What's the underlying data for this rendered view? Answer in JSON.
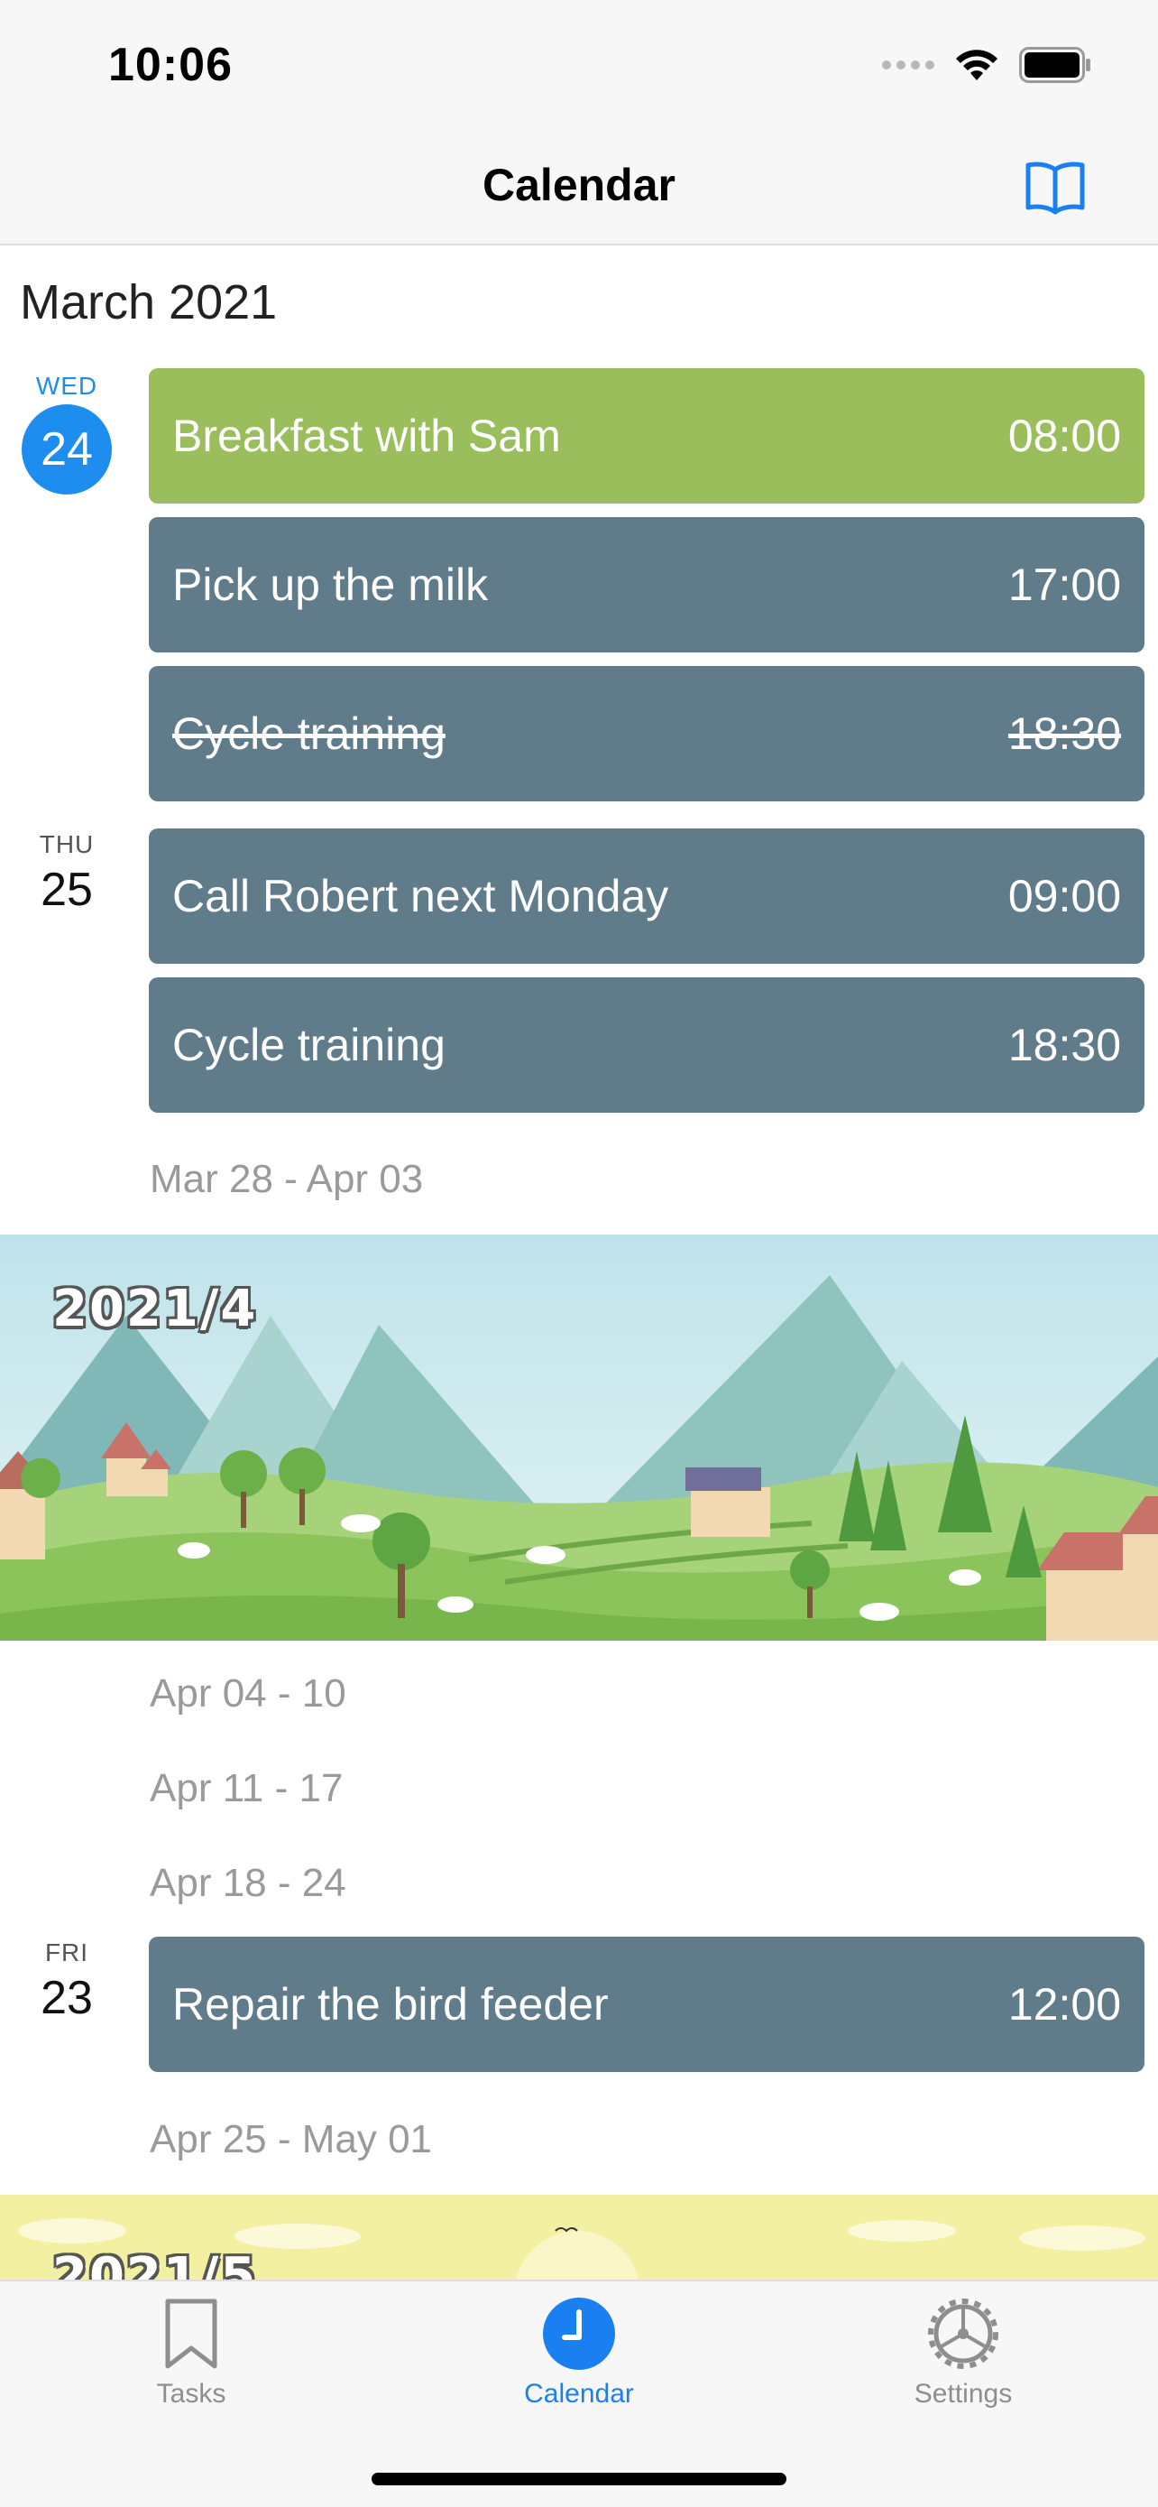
{
  "status_bar": {
    "time": "10:06"
  },
  "nav": {
    "title": "Calendar",
    "icon": "book-icon"
  },
  "month_title": "March 2021",
  "days": [
    {
      "dow": "WED",
      "date": "24",
      "today": true
    },
    {
      "dow": "THU",
      "date": "25"
    },
    {
      "dow": "FRI",
      "date": "23"
    }
  ],
  "events": [
    {
      "title": "Breakfast with Sam",
      "time": "08:00",
      "color": "#9bbe5c"
    },
    {
      "title": "Pick up the milk",
      "time": "17:00",
      "color": "#607b8a"
    },
    {
      "title": "Cycle training",
      "time": "18:30",
      "color": "#607b8a",
      "completed": true
    },
    {
      "title": "Call Robert next Monday",
      "time": "09:00",
      "color": "#607b8a"
    },
    {
      "title": "Cycle training",
      "time": "18:30",
      "color": "#607b8a"
    },
    {
      "title": "Repair the bird feeder",
      "time": "12:00",
      "color": "#607b8a"
    }
  ],
  "weeks": [
    "Mar 28 - Apr 03",
    "Apr 04 - 10",
    "Apr 11 - 17",
    "Apr 18 - 24",
    "Apr 25 - May 01"
  ],
  "banners": [
    {
      "year_label": "2021/4"
    },
    {
      "year_label": "2021/5"
    }
  ],
  "tabs": [
    {
      "label": "Tasks",
      "icon": "bookmark-icon"
    },
    {
      "label": "Calendar",
      "icon": "clock-icon",
      "active": true
    },
    {
      "label": "Settings",
      "icon": "gear-icon"
    }
  ],
  "colors": {
    "accent": "#1d8ef0",
    "event_green": "#9bbe5c",
    "event_slate": "#607b8a",
    "week_text": "#9a9a9a"
  }
}
